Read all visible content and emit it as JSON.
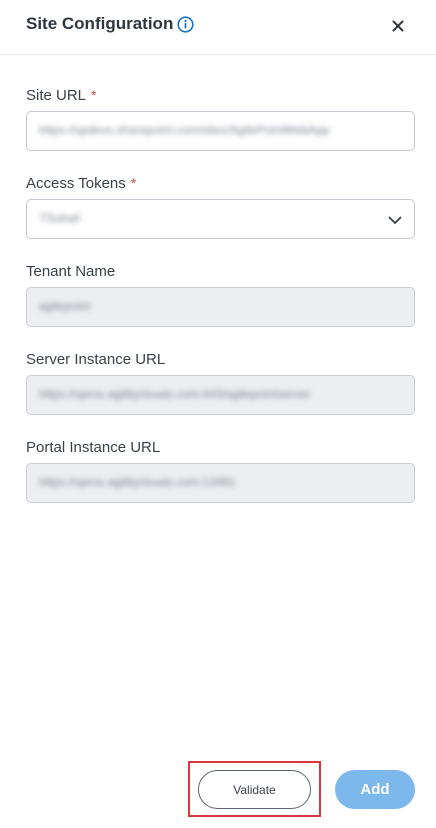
{
  "header": {
    "title": "Site Configuration"
  },
  "fields": {
    "site_url": {
      "label": "Site URL",
      "required_marker": "*",
      "value": "https://spdevs.sharepoint.com/sites/AgilePointWebApp"
    },
    "access_tokens": {
      "label": "Access Tokens",
      "required_marker": "*",
      "value": "TSuhail"
    },
    "tenant_name": {
      "label": "Tenant Name",
      "value": "agilepoint"
    },
    "server_instance_url": {
      "label": "Server Instance URL",
      "value": "https://sprox.agilitycloudz.com:443/agilepointserver"
    },
    "portal_instance_url": {
      "label": "Portal Instance URL",
      "value": "https://sprox.agilitycloudz.com:13491"
    }
  },
  "footer": {
    "validate_label": "Validate",
    "add_label": "Add"
  },
  "colors": {
    "primary_button": "#7cb8ec",
    "info_icon": "#1a73c8",
    "required": "#d64545",
    "highlight_box": "#d9363e"
  },
  "icons": {
    "info": "info-circle-icon",
    "close": "close-icon",
    "dropdown": "chevron-down-icon"
  }
}
